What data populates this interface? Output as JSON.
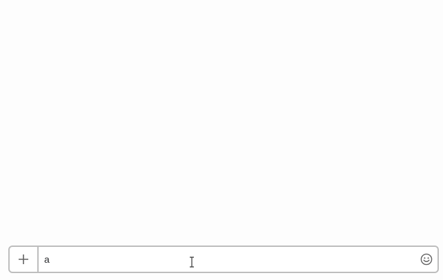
{
  "composer": {
    "value": "a",
    "placeholder": "",
    "add_icon": "plus-icon",
    "emoji_icon": "smiley-icon"
  },
  "colors": {
    "background": "#fdfdfd",
    "border": "#bdbdbd",
    "text": "#2c2d30",
    "icon": "#616061"
  }
}
